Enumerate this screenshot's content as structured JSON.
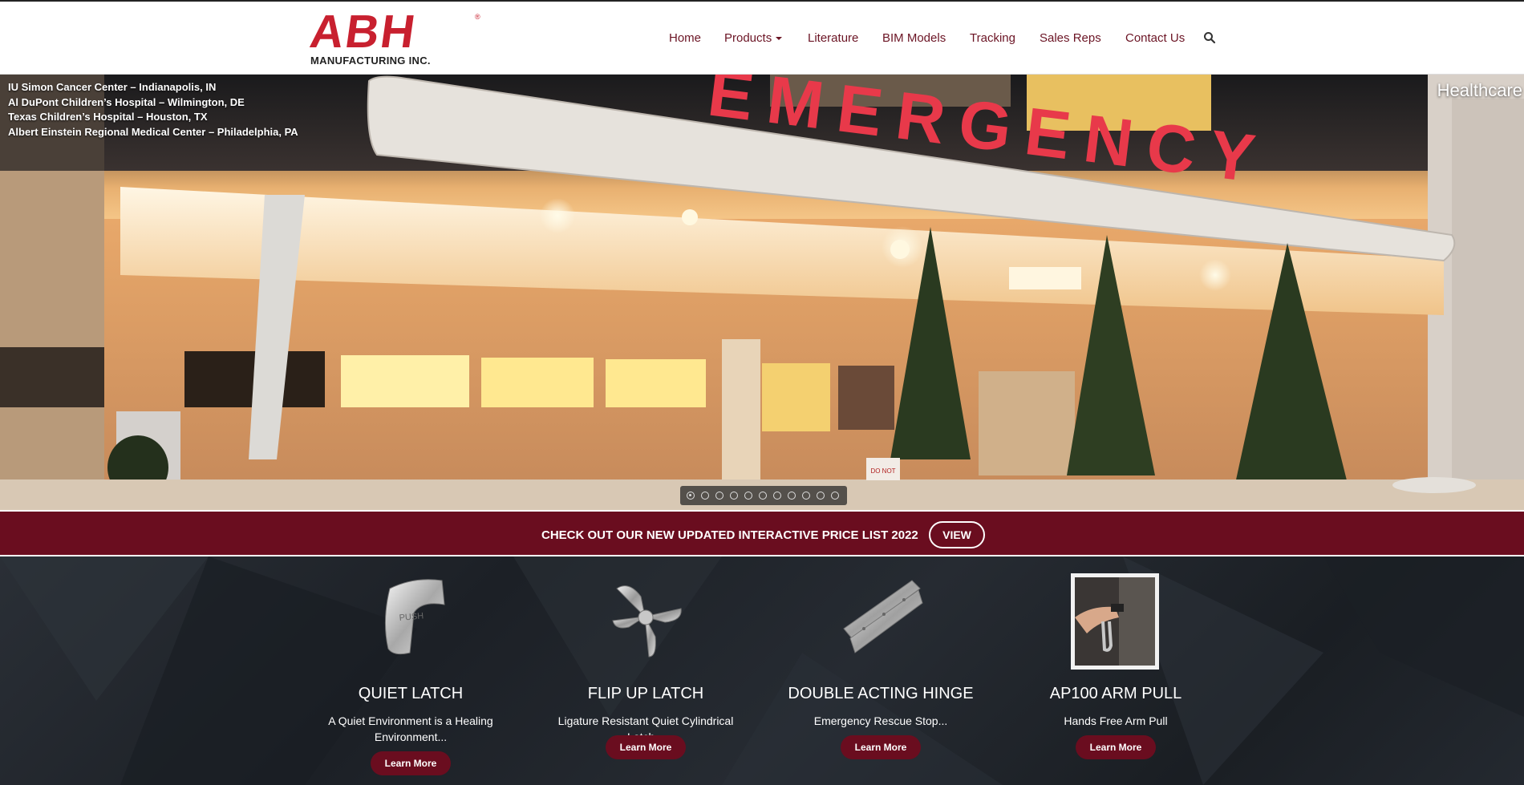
{
  "header": {
    "logo_text": "ABH",
    "logo_registered": "®",
    "logo_subtitle": "MANUFACTURING INC.",
    "nav": [
      {
        "label": "Home"
      },
      {
        "label": "Products"
      },
      {
        "label": "Literature"
      },
      {
        "label": "BIM Models"
      },
      {
        "label": "Tracking"
      },
      {
        "label": "Sales Reps"
      },
      {
        "label": "Contact Us"
      }
    ],
    "search_icon": "search-icon"
  },
  "hero": {
    "locations": [
      "IU Simon Cancer Center – Indianapolis, IN",
      "Al DuPont Children’s Hospital – Wilmington, DE",
      "Texas Children’s Hospital – Houston, TX",
      "Albert Einstein Regional Medical Center – Philadelphia, PA"
    ],
    "category": "Healthcare",
    "sign_text": "EMERGENCY",
    "small_sign": "DO NOT",
    "slide_count": 11,
    "active_slide": 1
  },
  "banner": {
    "text": "CHECK OUT OUR NEW UPDATED INTERACTIVE PRICE LIST 2022",
    "button": "VIEW"
  },
  "products": [
    {
      "title": "QUIET LATCH",
      "desc": "A Quiet Environment is a Healing Environment...",
      "button": "Learn More",
      "icon": "push-latch-image"
    },
    {
      "title": "FLIP UP LATCH",
      "desc": "Ligature Resistant Quiet Cylindrical Latch...",
      "button": "Learn More",
      "icon": "flip-latch-image"
    },
    {
      "title": "DOUBLE ACTING HINGE",
      "desc": "Emergency Rescue Stop...",
      "button": "Learn More",
      "icon": "hinge-image"
    },
    {
      "title": "AP100 ARM PULL",
      "desc": "Hands Free Arm Pull",
      "button": "Learn More",
      "icon": "arm-pull-image"
    }
  ],
  "colors": {
    "brand_red": "#c8202f",
    "banner_maroon": "#6a0d1f",
    "nav_text": "#6b1424"
  }
}
